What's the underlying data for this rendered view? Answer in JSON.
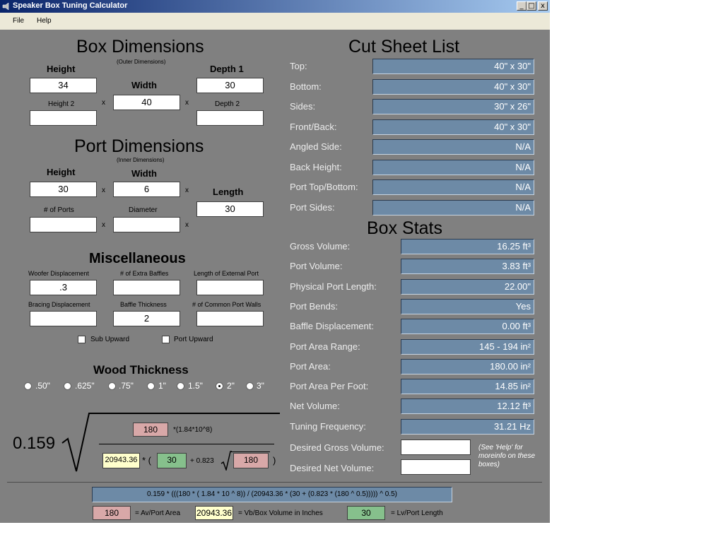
{
  "window": {
    "title": "Speaker Box Tuning Calculator",
    "buttons": [
      "_",
      "□",
      "x"
    ],
    "colors": {
      "titlebar": "#0a246a",
      "background": "#808080",
      "result_box": "#6d8aa6"
    }
  },
  "menu": [
    "File",
    "Help"
  ],
  "box_dimensions": {
    "title": "Box Dimensions",
    "note": "(Outer Dimensions)",
    "height_label": "Height",
    "height": "34",
    "height2_label": "Height 2",
    "height2": "",
    "width_label": "Width",
    "width": "40",
    "depth1_label": "Depth 1",
    "depth1": "30",
    "depth2_label": "Depth 2",
    "depth2": "",
    "times": "x"
  },
  "port_dimensions": {
    "title": "Port Dimensions",
    "note": "(Inner Dimensions)",
    "height_label": "Height",
    "height": "30",
    "width_label": "Width",
    "width": "6",
    "length_label": "Length",
    "length": "30",
    "ports_label": "# of Ports",
    "ports": "",
    "diameter_label": "Diameter",
    "diameter": ""
  },
  "misc": {
    "title": "Miscellaneous",
    "woofer_label": "Woofer Displacement",
    "woofer": ".3",
    "baffles_label": "# of Extra Baffles",
    "baffles": "",
    "ext_port_label": "Length of External Port",
    "ext_port": "",
    "bracing_label": "Bracing Displacement",
    "bracing": "",
    "baffle_thick_label": "Baffle Thickness",
    "baffle_thick": "2",
    "common_walls_label": "# of Common Port Walls",
    "common_walls": "",
    "sub_upward": "Sub Upward",
    "port_upward": "Port Upward"
  },
  "wood": {
    "title": "Wood Thickness",
    "options": [
      ".50\"",
      ".625\"",
      ".75\"",
      "1\"",
      "1.5\"",
      "2\"",
      "3\""
    ],
    "selected": "2\""
  },
  "formula": {
    "coef": "0.159",
    "av": "180",
    "mult": "*(1.84*10^8)",
    "vb": "20943.36",
    "star_paren": "* (",
    "lv": "30",
    "plus": "+ 0.823",
    "av2": "180",
    "close": ")"
  },
  "cut_sheet": {
    "title": "Cut Sheet List",
    "rows": [
      {
        "label": "Top:",
        "value": "40\" x 30\""
      },
      {
        "label": "Bottom:",
        "value": "40\" x 30\""
      },
      {
        "label": "Sides:",
        "value": "30\" x 26\""
      },
      {
        "label": "Front/Back:",
        "value": "40\" x 30\""
      },
      {
        "label": "Angled Side:",
        "value": "N/A"
      },
      {
        "label": "Back Height:",
        "value": "N/A"
      },
      {
        "label": "Port Top/Bottom:",
        "value": "N/A"
      },
      {
        "label": "Port Sides:",
        "value": "N/A"
      }
    ]
  },
  "box_stats": {
    "title": "Box Stats",
    "rows": [
      {
        "label": "Gross Volume:",
        "value": "16.25 ft³"
      },
      {
        "label": "Port Volume:",
        "value": "3.83 ft³"
      },
      {
        "label": "Physical Port Length:",
        "value": "22.00\""
      },
      {
        "label": "Port Bends:",
        "value": "Yes"
      },
      {
        "label": "Baffle Displacement:",
        "value": "0.00 ft³"
      },
      {
        "label": "Port Area Range:",
        "value": "145 - 194 in²"
      },
      {
        "label": "Port Area:",
        "value": "180.00 in²"
      },
      {
        "label": "Port Area Per Foot:",
        "value": "14.85 in²"
      },
      {
        "label": "Net Volume:",
        "value": "12.12 ft³"
      },
      {
        "label": "Tuning Frequency:",
        "value": "31.21 Hz"
      }
    ],
    "desired_gross_label": "Desired Gross Volume:",
    "desired_gross": "",
    "desired_net_label": "Desired Net Volume:",
    "desired_net": "",
    "help_note": "(See 'Help' for moreinfo on these boxes)"
  },
  "footer": {
    "expression": "0.159 * (((180 * ( 1.84 * 10 ^ 8)) / (20943.36 * (30 + (0.823 * (180 ^ 0.5))))) ^ 0.5)",
    "av": "180",
    "av_label": "= Av/Port Area",
    "vb": "20943.36",
    "vb_label": "= Vb/Box Volume in Inches",
    "lv": "30",
    "lv_label": "= Lv/Port Length"
  }
}
